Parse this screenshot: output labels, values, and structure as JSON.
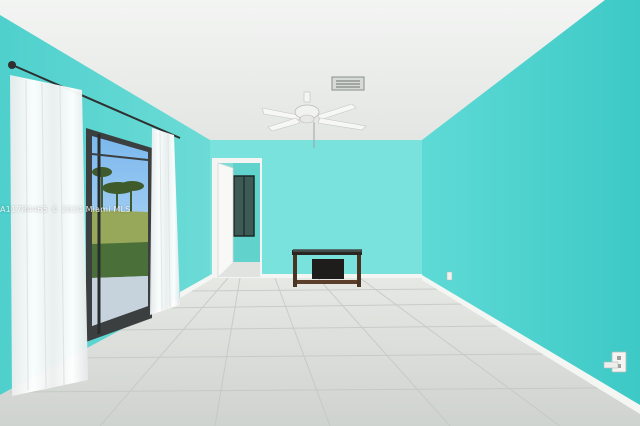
{
  "photo": {
    "watermark": "A11784465 © 2024 Miami MLS"
  },
  "colors": {
    "wall_right": "#45d2cf",
    "wall_back": "#79e2dc",
    "wall_left": "#5fd6d3",
    "ceiling": "#eef0ee",
    "floor": "#d9ddd8",
    "baseboard": "#f4f6f4",
    "sky": "#8ec4f0",
    "grass": "#98a85a",
    "curtain": "#f6f7f7"
  }
}
